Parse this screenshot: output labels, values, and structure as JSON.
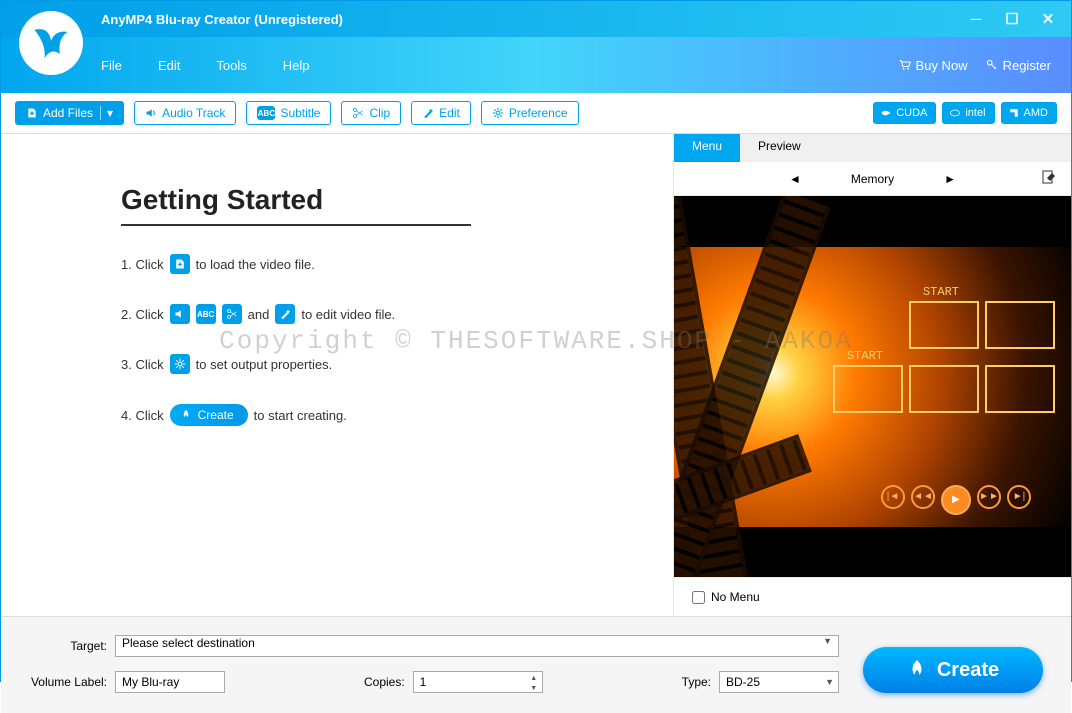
{
  "window": {
    "title": "AnyMP4 Blu-ray Creator (Unregistered)"
  },
  "menu": {
    "file": "File",
    "edit": "Edit",
    "tools": "Tools",
    "help": "Help",
    "buy": "Buy Now",
    "register": "Register"
  },
  "toolbar": {
    "add_files": "Add Files",
    "audio_track": "Audio Track",
    "subtitle": "Subtitle",
    "clip": "Clip",
    "edit": "Edit",
    "preference": "Preference",
    "cuda": "CUDA",
    "intel": "intel",
    "amd": "AMD"
  },
  "getting_started": {
    "title": "Getting Started",
    "step1_pre": "1. Click",
    "step1_post": "to load the video file.",
    "step2_pre": "2. Click",
    "step2_and": "and",
    "step2_post": "to edit video file.",
    "step3_pre": "3. Click",
    "step3_post": "to set output properties.",
    "step4_pre": "4. Click",
    "step4_btn": "Create",
    "step4_post": "to start creating."
  },
  "right": {
    "tab_menu": "Menu",
    "tab_preview": "Preview",
    "template": "Memory",
    "start": "START",
    "no_menu": "No Menu"
  },
  "bottom": {
    "target_label": "Target:",
    "target_value": "Please select destination",
    "vol_label": "Volume Label:",
    "vol_value": "My Blu-ray",
    "copies_label": "Copies:",
    "copies_value": "1",
    "type_label": "Type:",
    "type_value": "BD-25",
    "create": "Create"
  },
  "watermark": "Copyright © THESOFTWARE.SHOP - AAKOA"
}
